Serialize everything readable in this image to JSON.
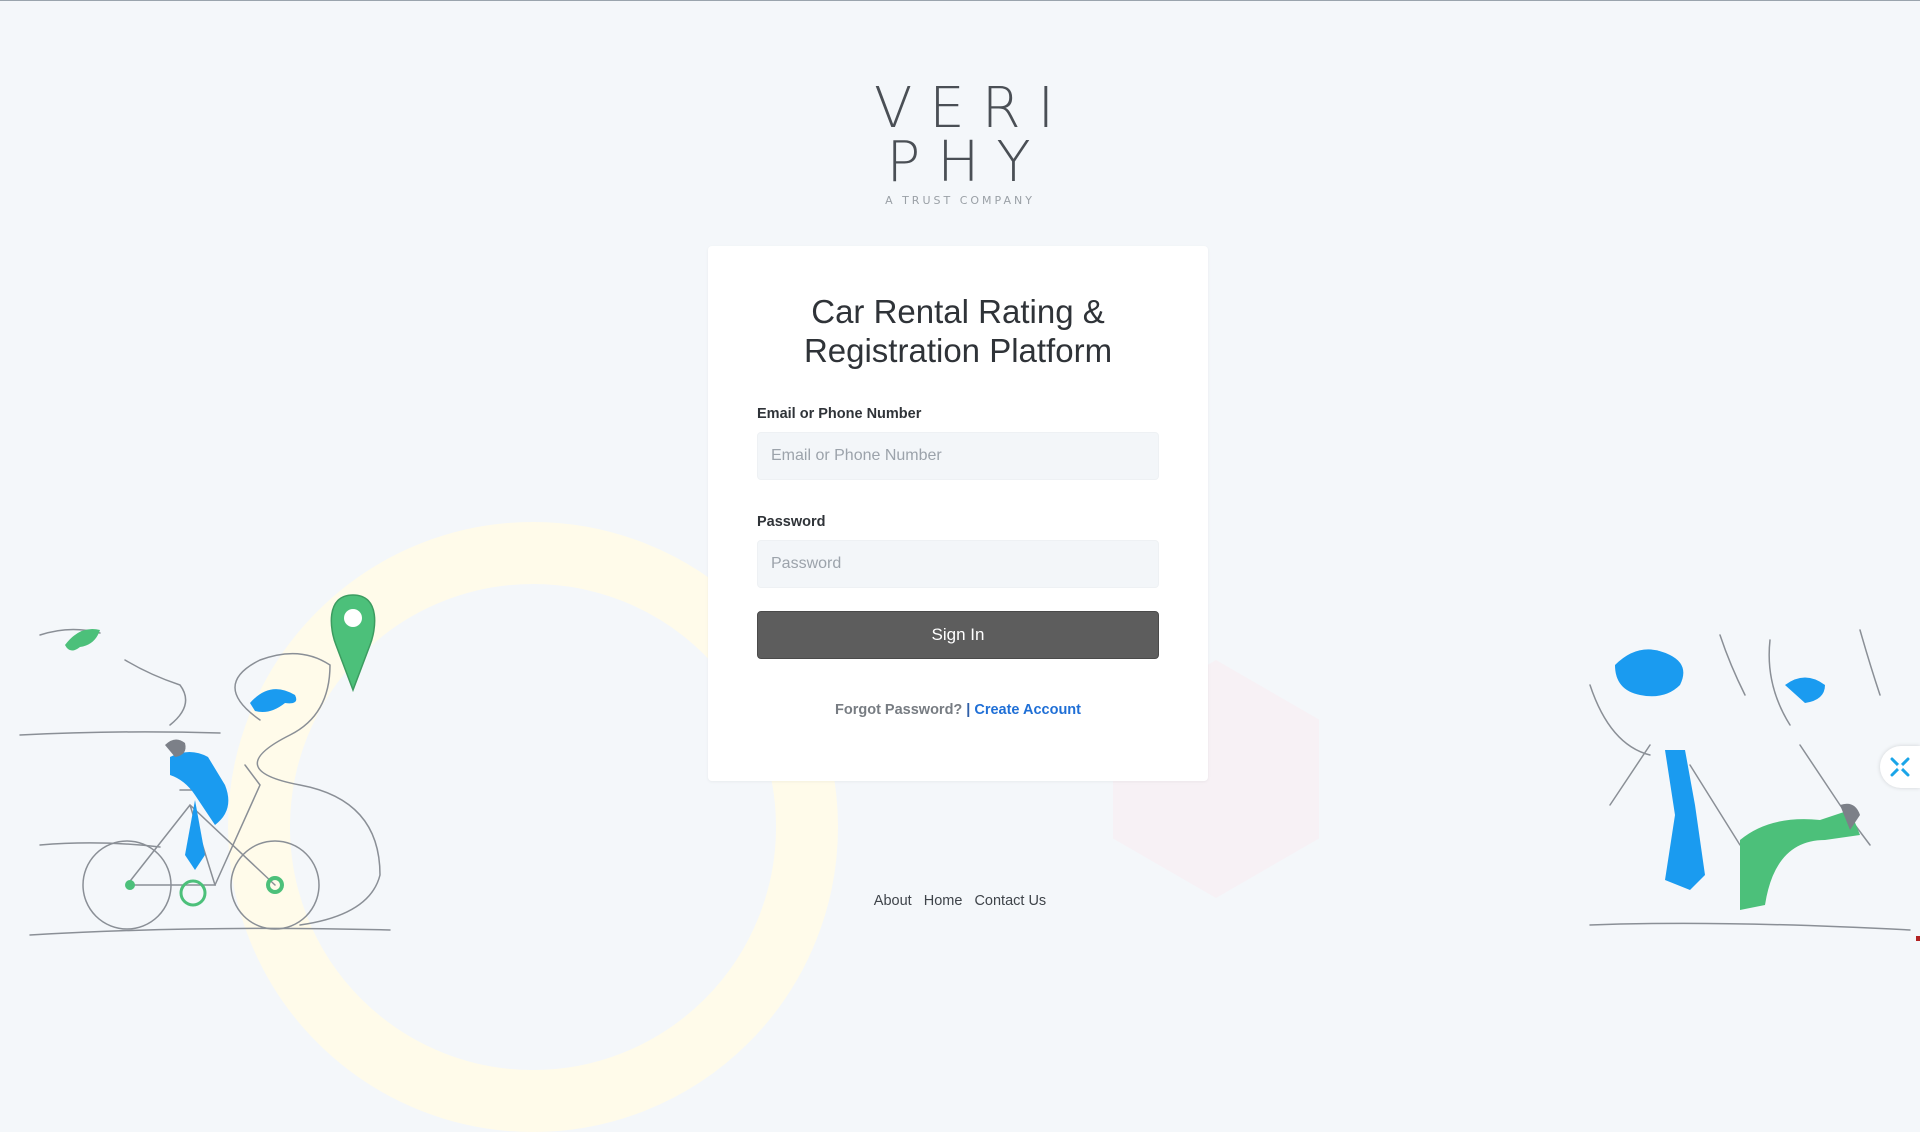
{
  "logo": {
    "line1": "VERI",
    "line2": "PHY",
    "tagline": "A TRUST COMPANY"
  },
  "card": {
    "title_line1": "Car Rental Rating &",
    "title_line2": "Registration Platform",
    "email_label": "Email or Phone Number",
    "email_placeholder": "Email or Phone Number",
    "email_value": "",
    "password_label": "Password",
    "password_placeholder": "Password",
    "password_value": "",
    "signin_label": "Sign In",
    "forgot_label": "Forgot Password?",
    "separator": "|",
    "create_label": "Create Account"
  },
  "footer": {
    "links": [
      "About",
      "Home",
      "Contact Us"
    ]
  },
  "colors": {
    "background": "#f4f7fa",
    "signin_button": "#5d5d5d",
    "link_blue": "#1f6fd6",
    "illustration_blue": "#1a9bf0",
    "illustration_green": "#4cc07a"
  },
  "icons": [
    "map-pin-icon",
    "chat-widget-icon"
  ]
}
